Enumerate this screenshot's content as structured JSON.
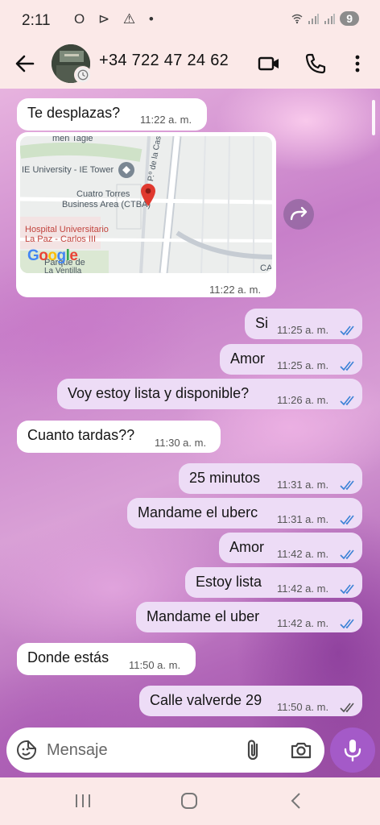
{
  "status_bar": {
    "time": "2:11",
    "icons_left": "O ⊳ ⚠ •",
    "battery": "9"
  },
  "header": {
    "contact_name": "+34 722 47 24 62"
  },
  "map": {
    "labels": {
      "street_top": "men Tagle",
      "ie_tower": "IE University - IE Tower",
      "cuatro_torres": "Cuatro Torres",
      "business_area": "Business Area (CTBA)",
      "hospital": "Hospital Universitario",
      "la_paz": "La Paz - Carlos III",
      "castellana": "P.º de la Castellana",
      "ventilla_top": "Parque de",
      "ventilla": "La Ventilla",
      "ca": "CA"
    },
    "google": [
      "G",
      "o",
      "o",
      "g",
      "l",
      "e"
    ],
    "time": "11:22 a. m."
  },
  "messages": [
    {
      "text": "Te desplazas?",
      "time": "11:22 a. m."
    },
    {
      "text": "Si",
      "time": "11:25 a. m."
    },
    {
      "text": "Amor",
      "time": "11:25 a. m."
    },
    {
      "text": "Voy estoy  lista y disponible?",
      "time": "11:26 a. m."
    },
    {
      "text": "Cuanto tardas??",
      "time": "11:30 a. m."
    },
    {
      "text": "25 minutos",
      "time": "11:31 a. m."
    },
    {
      "text": "Mandame el uberc",
      "time": "11:31 a. m."
    },
    {
      "text": "Amor",
      "time": "11:42 a. m."
    },
    {
      "text": "Estoy lista",
      "time": "11:42 a. m."
    },
    {
      "text": "Mandame el uber",
      "time": "11:42 a. m."
    },
    {
      "text": "Donde estás",
      "time": "11:50 a. m."
    },
    {
      "text": "Calle valverde 29",
      "time": "11:50 a. m."
    }
  ],
  "input": {
    "placeholder": "Mensaje"
  },
  "colors": {
    "accent": "#a45ac8",
    "read_ticks": "#3b82d6",
    "delivered_ticks": "#555555",
    "outgoing_bubble": "#eddcf6",
    "incoming_bubble": "#ffffff"
  },
  "icons": [
    "back-arrow-icon",
    "video-call-icon",
    "phone-icon",
    "more-vert-icon",
    "forward-icon",
    "emoji-icon",
    "attach-icon",
    "camera-icon",
    "mic-icon",
    "recents-icon",
    "home-icon",
    "back-nav-icon"
  ]
}
